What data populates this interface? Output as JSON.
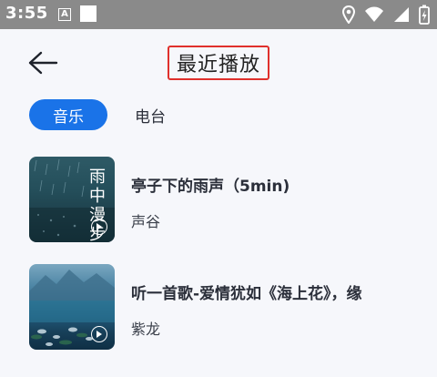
{
  "status_bar": {
    "time": "3:55",
    "notif_badge": "A",
    "icons": [
      "location-icon",
      "wifi-icon",
      "signal-icon",
      "battery-charging-icon"
    ]
  },
  "header": {
    "back_icon": "arrow-left-icon",
    "title": "最近播放"
  },
  "tabs": [
    {
      "label": "音乐",
      "active": true
    },
    {
      "label": "电台",
      "active": false
    }
  ],
  "items": [
    {
      "title": "亭子下的雨声（5min)",
      "subtitle": "声谷",
      "thumb_text": "雨中漫步"
    },
    {
      "title": "听一首歌-爱情犹如《海上花》，缘",
      "subtitle": "紫龙"
    }
  ],
  "colors": {
    "accent": "#1a73e8",
    "title_highlight_border": "#e0302c",
    "background": "#f6f7fb",
    "status_bar": "#8a8a8a"
  }
}
